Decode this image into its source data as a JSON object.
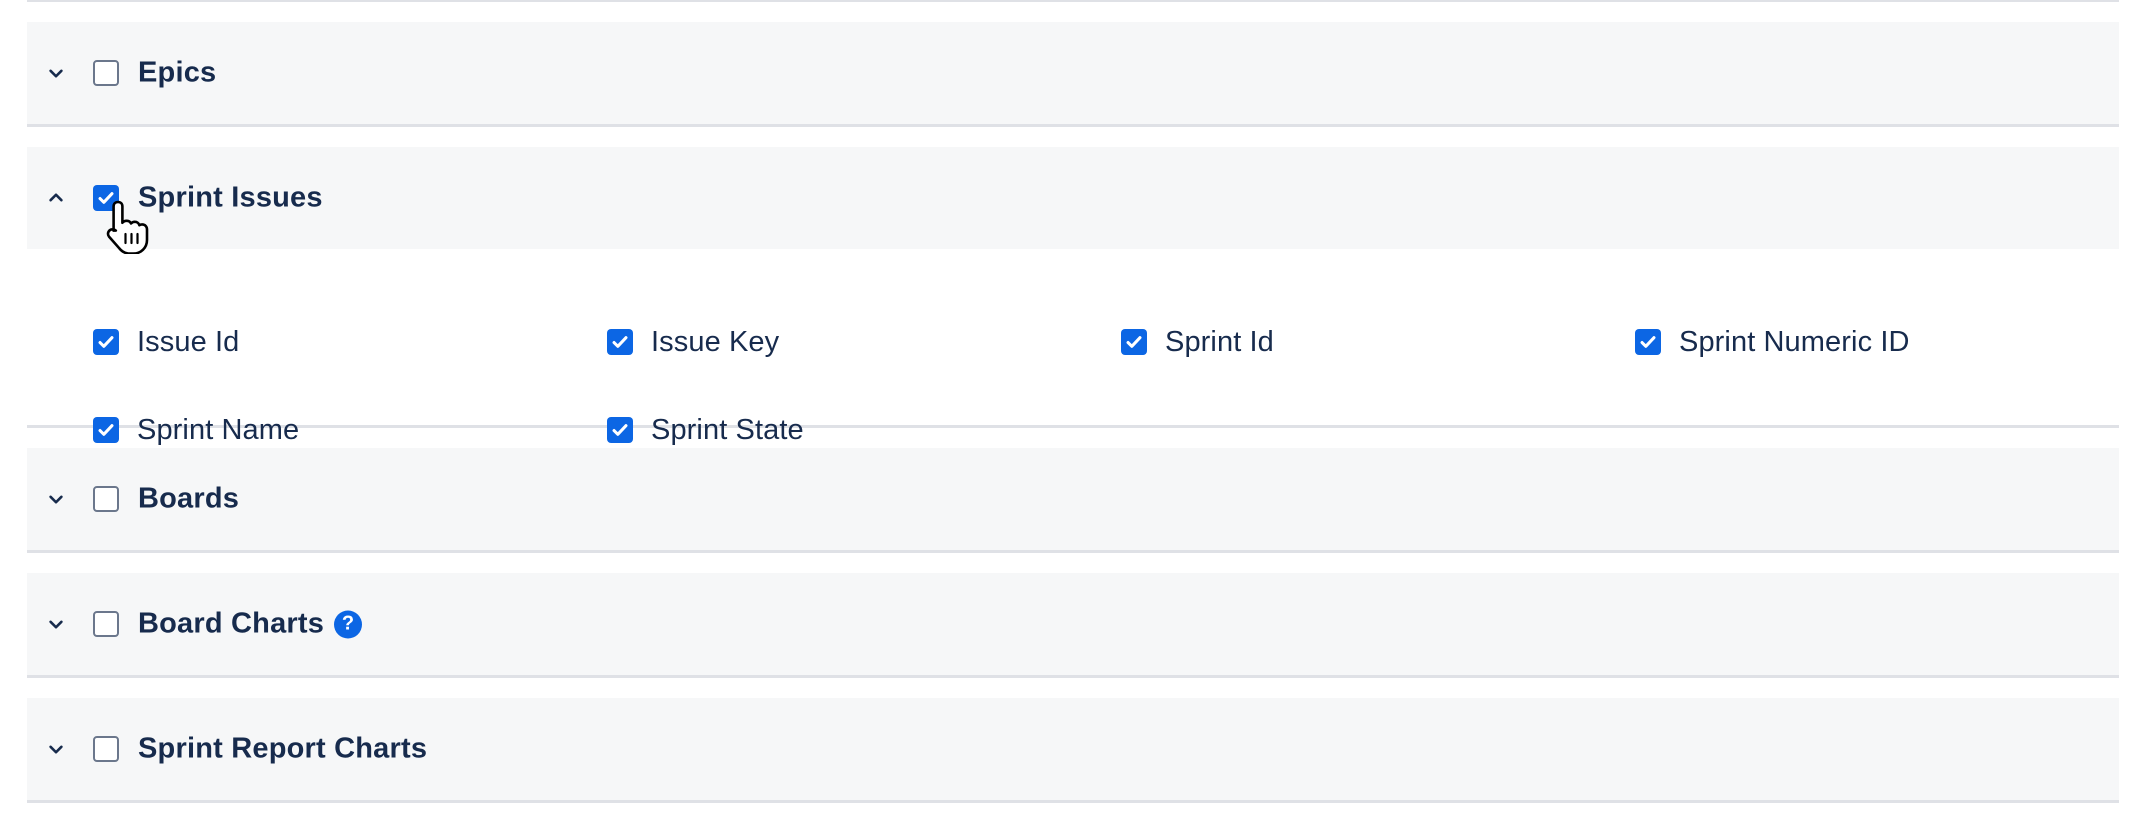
{
  "sections": [
    {
      "title": "Epics",
      "expanded": false,
      "checked": false
    },
    {
      "title": "Sprint Issues",
      "expanded": true,
      "checked": true,
      "fields": [
        {
          "label": "Issue Id",
          "checked": true
        },
        {
          "label": "Issue Key",
          "checked": true
        },
        {
          "label": "Sprint Id",
          "checked": true
        },
        {
          "label": "Sprint Numeric ID",
          "checked": true
        },
        {
          "label": "Sprint Name",
          "checked": true
        },
        {
          "label": "Sprint State",
          "checked": true
        }
      ]
    },
    {
      "title": "Boards",
      "expanded": false,
      "checked": false
    },
    {
      "title": "Board Charts",
      "expanded": false,
      "checked": false,
      "help_icon": "question-circle-icon",
      "help_symbol": "?"
    },
    {
      "title": "Sprint Report Charts",
      "expanded": false,
      "checked": false
    }
  ],
  "colors": {
    "accent": "#0c66e4",
    "header_bg": "#f6f7f8",
    "text": "#172b4d",
    "divider": "#dfe1e6"
  },
  "cursor": "hand-pointer-icon"
}
